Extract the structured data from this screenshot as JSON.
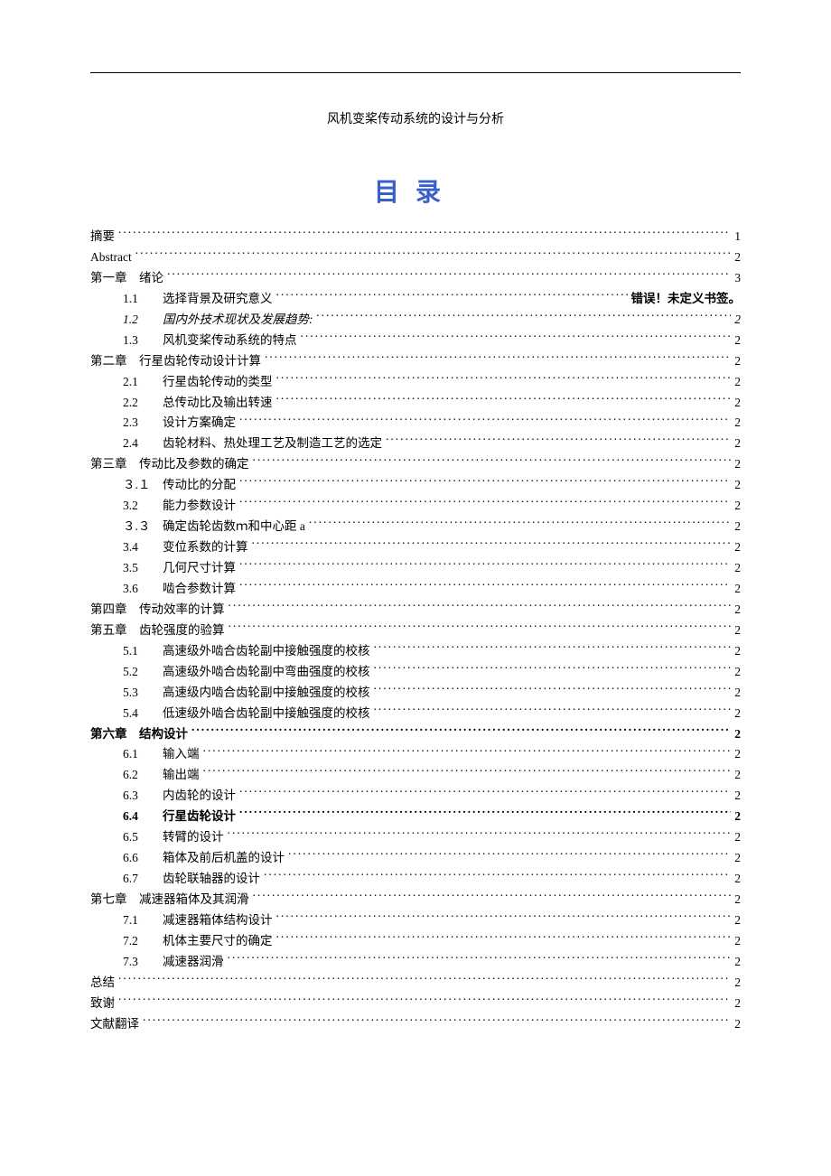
{
  "doc_title": "风机变桨传动系统的设计与分析",
  "toc_heading": "目录",
  "error_text": "错误！未定义书签。",
  "toc": [
    {
      "level": 1,
      "num": "",
      "label": "摘要",
      "page": "1"
    },
    {
      "level": 1,
      "num": "",
      "label": "Abstract",
      "page": "2"
    },
    {
      "level": 1,
      "num": "第一章",
      "label": "绪论",
      "page": "3"
    },
    {
      "level": 2,
      "num": "1.1",
      "label": "选择背景及研究意义",
      "page": "error"
    },
    {
      "level": 2,
      "num": "1.2",
      "label": "国内外技术现状及发展趋势:",
      "page": "2",
      "classes": "italic"
    },
    {
      "level": 2,
      "num": "1.3",
      "label": "风机变桨传动系统的特点",
      "page": "2"
    },
    {
      "level": 1,
      "num": "第二章",
      "label": "行星齿轮传动设计计算",
      "page": "2"
    },
    {
      "level": 2,
      "num": "2.1",
      "label": "行星齿轮传动的类型",
      "page": "2"
    },
    {
      "level": 2,
      "num": "2.2",
      "label": "总传动比及输出转速",
      "page": "2"
    },
    {
      "level": 2,
      "num": "2.3",
      "label": "设计方案确定",
      "page": "2"
    },
    {
      "level": 2,
      "num": "2.4",
      "label": "齿轮材料、热处理工艺及制造工艺的选定",
      "page": "2"
    },
    {
      "level": 1,
      "num": "第三章",
      "label": "传动比及参数的确定",
      "page": "2"
    },
    {
      "level": 2,
      "num": "３.１",
      "label": "传动比的分配",
      "page": "2",
      "spaced": true
    },
    {
      "level": 2,
      "num": "3.2",
      "label": "能力参数设计",
      "page": "2"
    },
    {
      "level": 2,
      "num": "３.３",
      "label": "确定齿轮齿数ｍ和中心距 a",
      "page": "2",
      "spaced": true
    },
    {
      "level": 2,
      "num": "3.4",
      "label": "变位系数的计算",
      "page": "2"
    },
    {
      "level": 2,
      "num": "3.5",
      "label": "几何尺寸计算",
      "page": "2"
    },
    {
      "level": 2,
      "num": "3.6",
      "label": "啮合参数计算",
      "page": "2"
    },
    {
      "level": 1,
      "num": "第四章",
      "label": "传动效率的计算",
      "page": "2"
    },
    {
      "level": 1,
      "num": "第五章",
      "label": "齿轮强度的验算",
      "page": "2"
    },
    {
      "level": 2,
      "num": "5.1",
      "label": "高速级外啮合齿轮副中接触强度的校核",
      "page": "2"
    },
    {
      "level": 2,
      "num": "5.2",
      "label": "高速级外啮合齿轮副中弯曲强度的校核",
      "page": "2"
    },
    {
      "level": 2,
      "num": "5.3",
      "label": "高速级内啮合齿轮副中接触强度的校核",
      "page": "2"
    },
    {
      "level": 2,
      "num": "5.4",
      "label": "低速级外啮合齿轮副中接触强度的校核",
      "page": "2"
    },
    {
      "level": 1,
      "num": "第六章",
      "label": "结构设计",
      "page": "2",
      "classes": "bold"
    },
    {
      "level": 2,
      "num": "6.1",
      "label": "输入端",
      "page": "2"
    },
    {
      "level": 2,
      "num": "6.2",
      "label": "输出端",
      "page": "2"
    },
    {
      "level": 2,
      "num": "6.3",
      "label": "内齿轮的设计",
      "page": "2"
    },
    {
      "level": 2,
      "num": "6.4",
      "label": "行星齿轮设计",
      "page": "2",
      "classes": "bold"
    },
    {
      "level": 2,
      "num": "6.5",
      "label": "转臂的设计",
      "page": "2"
    },
    {
      "level": 2,
      "num": "6.6",
      "label": "箱体及前后机盖的设计",
      "page": "2"
    },
    {
      "level": 2,
      "num": "6.7",
      "label": "齿轮联轴器的设计",
      "page": "2"
    },
    {
      "level": 1,
      "num": "第七章",
      "label": "减速器箱体及其润滑",
      "page": "2"
    },
    {
      "level": 2,
      "num": "7.1",
      "label": "减速器箱体结构设计",
      "page": "2"
    },
    {
      "level": 2,
      "num": "7.2",
      "label": "机体主要尺寸的确定",
      "page": "2"
    },
    {
      "level": 2,
      "num": "7.3",
      "label": "减速器润滑",
      "page": "2"
    },
    {
      "level": 1,
      "num": "",
      "label": "总结",
      "page": "2"
    },
    {
      "level": 1,
      "num": "",
      "label": "致谢",
      "page": "2"
    },
    {
      "level": 1,
      "num": "",
      "label": "文献翻译",
      "page": "2"
    }
  ]
}
